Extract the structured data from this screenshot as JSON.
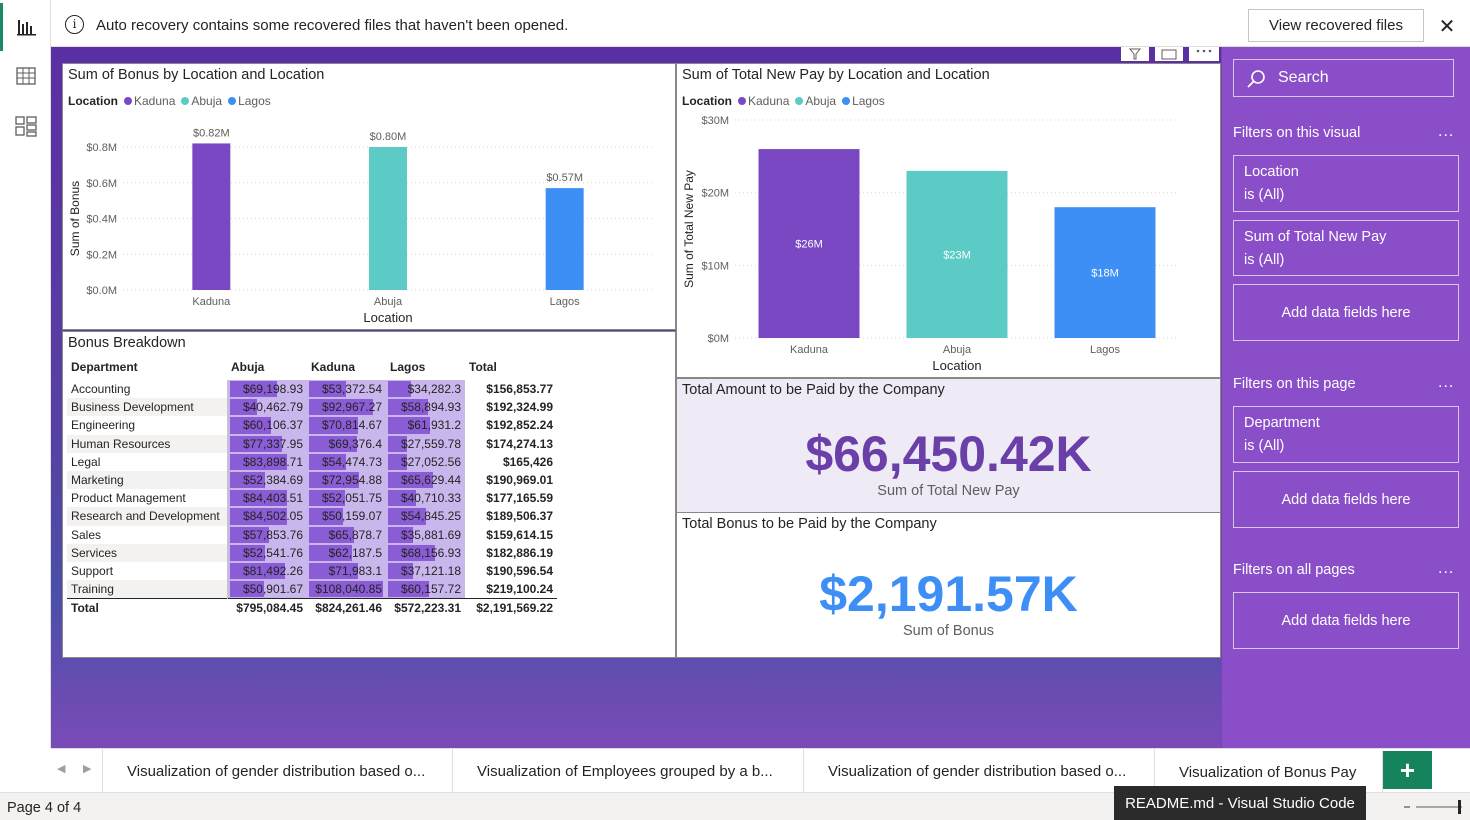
{
  "notification": {
    "message": "Auto recovery contains some recovered files that haven't been opened.",
    "button_label": "View recovered files",
    "close_glyph": "✕"
  },
  "rail": {
    "icons": [
      "report-icon",
      "table-icon",
      "model-icon"
    ]
  },
  "bonus_chart": {
    "title": "Sum of Bonus by Location and Location",
    "legend_title": "Location",
    "ylabel": "Sum of Bonus",
    "xlabel": "Location"
  },
  "pay_chart": {
    "title": "Sum of Total New Pay by Location and Location",
    "legend_title": "Location",
    "ylabel": "Sum of Total New Pay",
    "xlabel": "Location"
  },
  "chart_data": [
    {
      "type": "bar",
      "title": "Sum of Bonus by Location and Location",
      "categories": [
        "Kaduna",
        "Abuja",
        "Lagos"
      ],
      "values": [
        0.82,
        0.8,
        0.57
      ],
      "data_labels": [
        "$0.82M",
        "$0.80M",
        "$0.57M"
      ],
      "colors": [
        "#7b48c4",
        "#5ccbc6",
        "#3d8ff5"
      ],
      "legend": [
        "Kaduna",
        "Abuja",
        "Lagos"
      ],
      "yticks": [
        "$0.0M",
        "$0.2M",
        "$0.4M",
        "$0.6M",
        "$0.8M"
      ],
      "ylim": [
        0,
        0.8
      ],
      "xlabel": "Location",
      "ylabel": "Sum of Bonus",
      "grid": true,
      "legend_placement": "top-left"
    },
    {
      "type": "bar",
      "title": "Sum of Total New Pay by Location and Location",
      "categories": [
        "Kaduna",
        "Abuja",
        "Lagos"
      ],
      "values": [
        26,
        23,
        18
      ],
      "data_labels": [
        "$26M",
        "$23M",
        "$18M"
      ],
      "colors": [
        "#7b48c4",
        "#5ccbc6",
        "#3d8ff5"
      ],
      "legend": [
        "Kaduna",
        "Abuja",
        "Lagos"
      ],
      "yticks": [
        "$0M",
        "$10M",
        "$20M",
        "$30M"
      ],
      "ylim": [
        0,
        30
      ],
      "xlabel": "Location",
      "ylabel": "Sum of Total New Pay",
      "grid": true,
      "legend_placement": "top-left"
    }
  ],
  "breakdown": {
    "title": "Bonus Breakdown",
    "columns": [
      "Department",
      "Abuja",
      "Kaduna",
      "Lagos",
      "Total"
    ],
    "rows": [
      {
        "dept": "Accounting",
        "abuja": "$69,198.93",
        "kaduna": "$53,372.54",
        "lagos": "$34,282.3",
        "total": "$156,853.77",
        "a": 69198.93,
        "k": 53372.54,
        "l": 34282.3
      },
      {
        "dept": "Business Development",
        "abuja": "$40,462.79",
        "kaduna": "$92,967.27",
        "lagos": "$58,894.93",
        "total": "$192,324.99",
        "a": 40462.79,
        "k": 92967.27,
        "l": 58894.93
      },
      {
        "dept": "Engineering",
        "abuja": "$60,106.37",
        "kaduna": "$70,814.67",
        "lagos": "$61,931.2",
        "total": "$192,852.24",
        "a": 60106.37,
        "k": 70814.67,
        "l": 61931.2
      },
      {
        "dept": "Human Resources",
        "abuja": "$77,337.95",
        "kaduna": "$69,376.4",
        "lagos": "$27,559.78",
        "total": "$174,274.13",
        "a": 77337.95,
        "k": 69376.4,
        "l": 27559.78
      },
      {
        "dept": "Legal",
        "abuja": "$83,898.71",
        "kaduna": "$54,474.73",
        "lagos": "$27,052.56",
        "total": "$165,426",
        "a": 83898.71,
        "k": 54474.73,
        "l": 27052.56
      },
      {
        "dept": "Marketing",
        "abuja": "$52,384.69",
        "kaduna": "$72,954.88",
        "lagos": "$65,629.44",
        "total": "$190,969.01",
        "a": 52384.69,
        "k": 72954.88,
        "l": 65629.44
      },
      {
        "dept": "Product Management",
        "abuja": "$84,403.51",
        "kaduna": "$52,051.75",
        "lagos": "$40,710.33",
        "total": "$177,165.59",
        "a": 84403.51,
        "k": 52051.75,
        "l": 40710.33
      },
      {
        "dept": "Research and Development",
        "abuja": "$84,502.05",
        "kaduna": "$50,159.07",
        "lagos": "$54,845.25",
        "total": "$189,506.37",
        "a": 84502.05,
        "k": 50159.07,
        "l": 54845.25
      },
      {
        "dept": "Sales",
        "abuja": "$57,853.76",
        "kaduna": "$65,878.7",
        "lagos": "$35,881.69",
        "total": "$159,614.15",
        "a": 57853.76,
        "k": 65878.7,
        "l": 35881.69
      },
      {
        "dept": "Services",
        "abuja": "$52,541.76",
        "kaduna": "$62,187.5",
        "lagos": "$68,156.93",
        "total": "$182,886.19",
        "a": 52541.76,
        "k": 62187.5,
        "l": 68156.93
      },
      {
        "dept": "Support",
        "abuja": "$81,492.26",
        "kaduna": "$71,983.1",
        "lagos": "$37,121.18",
        "total": "$190,596.54",
        "a": 81492.26,
        "k": 71983.1,
        "l": 37121.18
      },
      {
        "dept": "Training",
        "abuja": "$50,901.67",
        "kaduna": "$108,040.85",
        "lagos": "$60,157.72",
        "total": "$219,100.24",
        "a": 50901.67,
        "k": 108040.85,
        "l": 60157.72
      }
    ],
    "total_row": {
      "dept": "Total",
      "abuja": "$795,084.45",
      "kaduna": "$824,261.46",
      "lagos": "$572,223.31",
      "total": "$2,191,569.22"
    }
  },
  "card_amount": {
    "title": "Total Amount to be Paid by the Company",
    "value": "$66,450.42K",
    "label": "Sum of Total New Pay",
    "color": "#6b3fa8"
  },
  "card_bonus": {
    "title": "Total Bonus to be Paid by the Company",
    "value": "$2,191.57K",
    "label": "Sum of Bonus",
    "color": "#3d8ff5"
  },
  "filters": {
    "search_placeholder": "Search",
    "visual_section": "Filters on this visual",
    "page_section": "Filters on this page",
    "all_section": "Filters on all pages",
    "more": "...",
    "visual_cards": [
      {
        "field": "Location",
        "state": "is (All)"
      },
      {
        "field": "Sum of Total New Pay",
        "state": "is (All)"
      }
    ],
    "page_cards": [
      {
        "field": "Department",
        "state": "is (All)"
      }
    ],
    "add_label": "Add data fields here"
  },
  "tabs": [
    {
      "label": "Visualization of gender distribution based o...",
      "active": false
    },
    {
      "label": "Visualization of Employees grouped by a b...",
      "active": false
    },
    {
      "label": "Visualization of gender distribution based o...",
      "active": false
    },
    {
      "label": "Visualization of Bonus Pay",
      "active": true
    }
  ],
  "add_tab_glyph": "+",
  "status": {
    "page": "Page 4 of 4",
    "tooltip": "README.md - Visual Studio Code"
  },
  "colors": {
    "kaduna": "#7b48c4",
    "abuja": "#5ccbc6",
    "lagos": "#3d8ff5",
    "filter_pane": "#8a4ec9"
  }
}
